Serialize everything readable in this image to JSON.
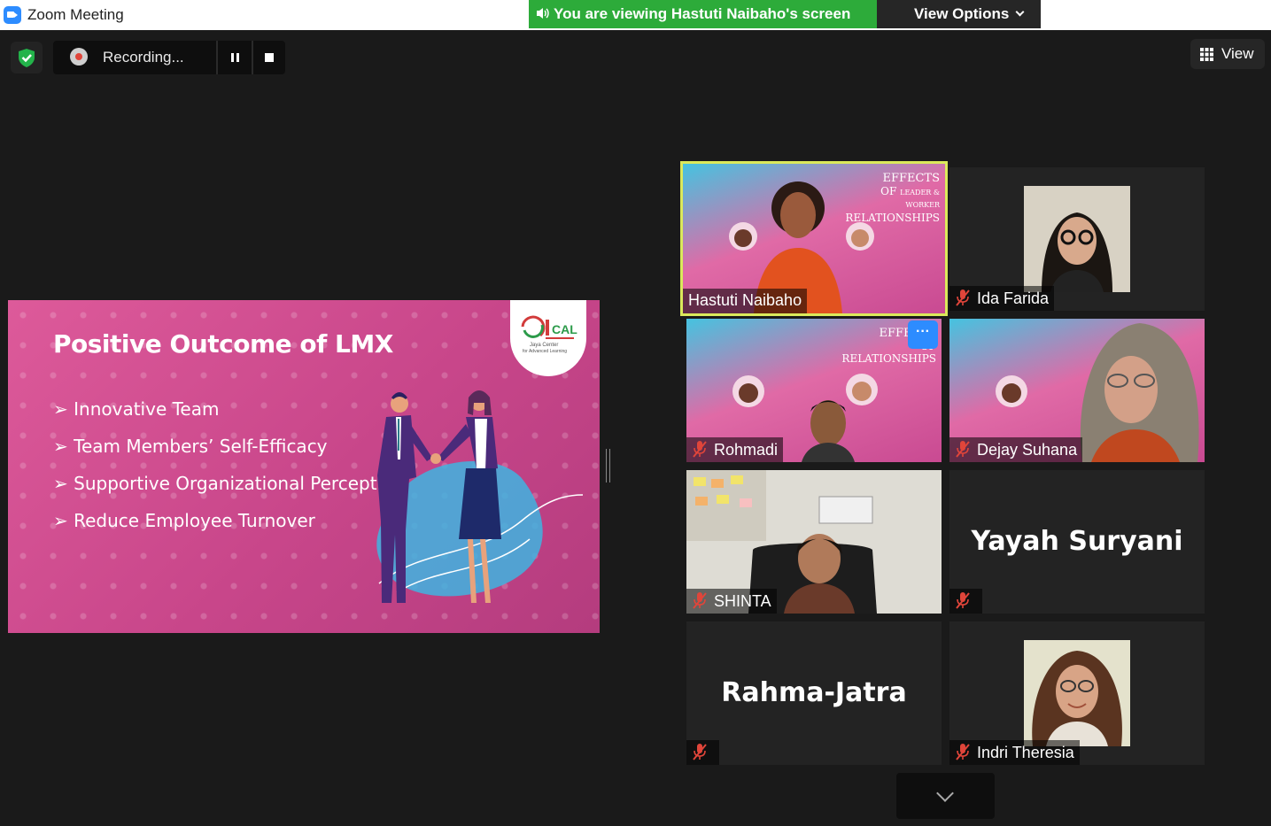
{
  "window": {
    "title": "Zoom Meeting",
    "viewing_banner": "You are viewing Hastuti Naibaho's screen",
    "view_options_label": "View Options"
  },
  "toolbar": {
    "recording_label": "Recording...",
    "view_label": "View"
  },
  "colors": {
    "banner_green": "#2dab3a",
    "zoom_blue": "#2d8cff",
    "active_speaker_outline": "#dbe95b",
    "muted_red": "#e0453a",
    "slide_pink": "#d5509a"
  },
  "slide": {
    "title": "Positive Outcome of LMX",
    "bullets": [
      "Innovative Team",
      "Team Members’ Self-Efficacy",
      "Supportive Organizational Perception",
      "Reduce Employee Turnover"
    ],
    "logo_text": "JCAL",
    "logo_caption": "Jaya Center for Advanced Learning"
  },
  "poster": {
    "line1": "EFFECTS",
    "line2": "OF",
    "line3": "LEADER &",
    "line4": "WORKER",
    "line5": "RELATIONSHIPS"
  },
  "participants": [
    {
      "name": "Hastuti Naibaho",
      "muted": false,
      "active": true,
      "video": "poster-speaker"
    },
    {
      "name": "Ida Farida",
      "muted": true,
      "active": false,
      "video": "camera"
    },
    {
      "name": "Rohmadi",
      "muted": true,
      "active": false,
      "video": "poster"
    },
    {
      "name": "Dejay Suhana",
      "muted": true,
      "active": false,
      "video": "poster"
    },
    {
      "name": "SHINTA",
      "muted": true,
      "active": false,
      "video": "camera"
    },
    {
      "name": "Yayah Suryani",
      "muted": true,
      "active": false,
      "video": "off"
    },
    {
      "name": "Rahma-Jatra",
      "muted": true,
      "active": false,
      "video": "off"
    },
    {
      "name": "Indri Theresia",
      "muted": true,
      "active": false,
      "video": "camera"
    }
  ],
  "icons": {
    "app": "zoom-logo-icon",
    "speaker": "speaker-icon",
    "shield": "security-shield-icon",
    "record": "record-dot-icon",
    "pause": "pause-icon",
    "stop": "stop-icon",
    "grid": "grid-view-icon",
    "mic_off": "mic-off-icon",
    "more": "more-options-icon",
    "scroll": "chevron-down-icon"
  }
}
